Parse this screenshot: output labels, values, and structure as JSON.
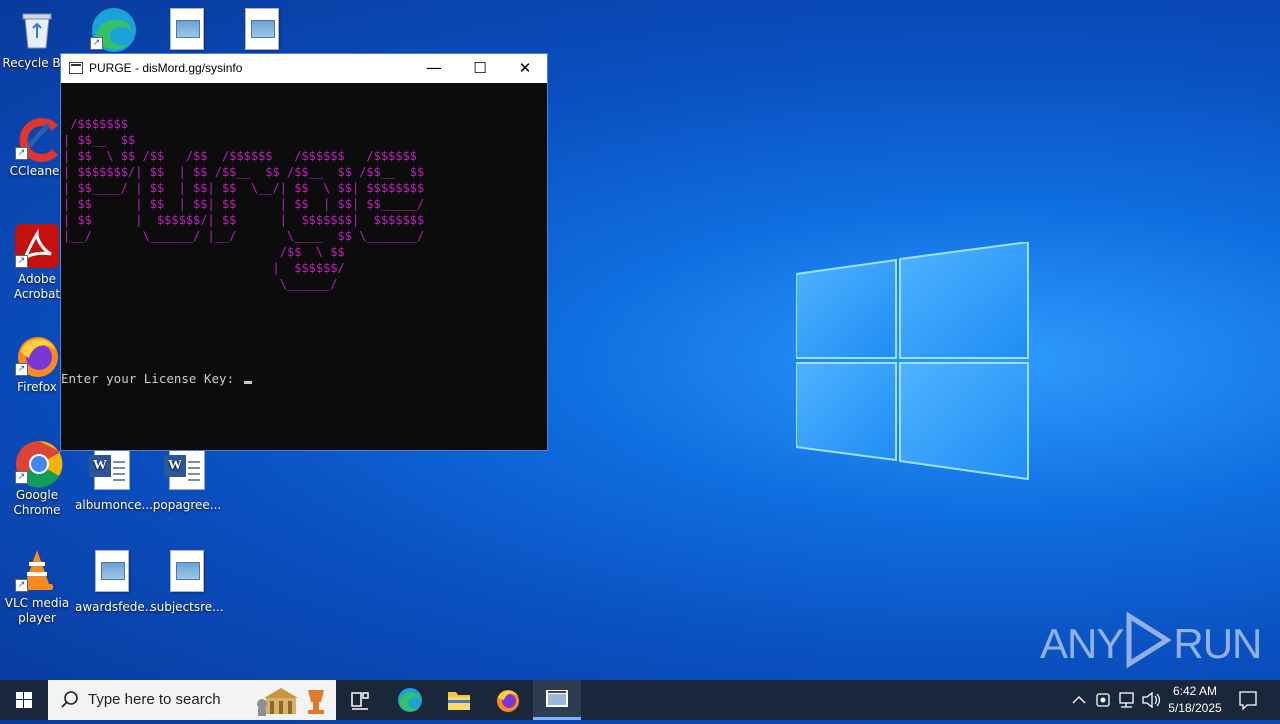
{
  "desktop": {
    "icons": [
      {
        "label": "Recycle Bin"
      },
      {
        "label": "Microsoft Edge"
      },
      {
        "label": ""
      },
      {
        "label": ""
      },
      {
        "label": "CCleaner"
      },
      {
        "label": "Adobe Acrobat"
      },
      {
        "label": "Firefox"
      },
      {
        "label": "Google Chrome"
      },
      {
        "label": "albumonce..."
      },
      {
        "label": "popagree..."
      },
      {
        "label": "VLC media player"
      },
      {
        "label": "awardsfede..."
      },
      {
        "label": "subjectsre..."
      }
    ]
  },
  "window": {
    "title": "PURGE - disMord.gg/sysinfo",
    "minimize": "—",
    "maximize": "☐",
    "close": "✕",
    "ascii_art": " /$$$$$$$\n| $$__  $$\n| $$  \\ $$ /$$   /$$  /$$$$$$   /$$$$$$   /$$$$$$\n| $$$$$$$/| $$  | $$ /$$__  $$ /$$__  $$ /$$__  $$\n| $$____/ | $$  | $$| $$  \\__/| $$  \\ $$| $$$$$$$$\n| $$      | $$  | $$| $$      | $$  | $$| $$_____/\n| $$      |  $$$$$$/| $$      |  $$$$$$$|  $$$$$$$\n|__/       \\______/ |__/       \\____  $$ \\_______/\n                              /$$  \\ $$\n                             |  $$$$$$/\n                              \\______/",
    "prompt": "Enter your License Key: "
  },
  "watermark": {
    "left": "ANY",
    "right": "RUN"
  },
  "taskbar": {
    "search_placeholder": "Type here to search",
    "time": "6:42 AM",
    "date": "5/18/2025"
  },
  "colors": {
    "ascii": "#c21ec2",
    "taskbar": "#1a2639"
  }
}
